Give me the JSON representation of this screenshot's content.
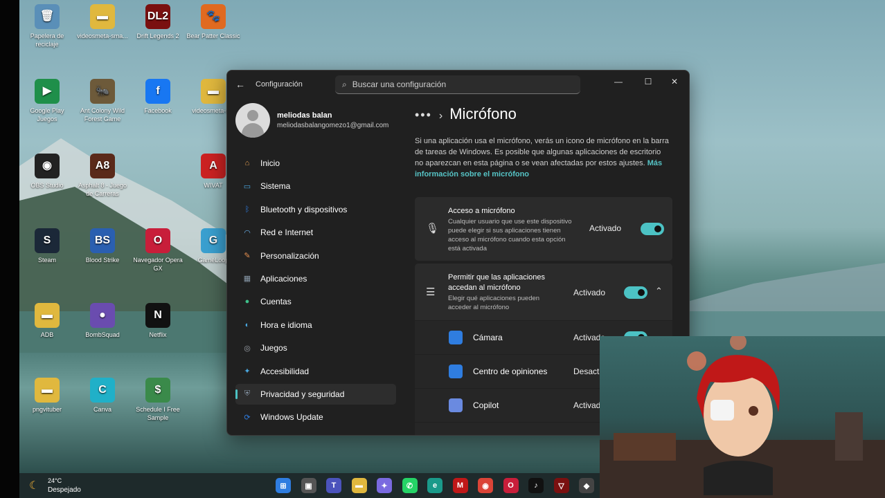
{
  "desktop": {
    "icons": [
      {
        "label": "Papelera de reciclaje",
        "glyph": "🗑",
        "color": "#5a8fb8"
      },
      {
        "label": "videosmeta-sma...",
        "glyph": "▬",
        "color": "#e0b83e"
      },
      {
        "label": "Drift Legends 2",
        "glyph": "DL2",
        "color": "#7a1010"
      },
      {
        "label": "Bear Patter Classic",
        "glyph": "🐾",
        "color": "#e06a20"
      },
      {
        "label": "Google Play Juegos",
        "glyph": "▶",
        "color": "#1f8f4a"
      },
      {
        "label": "Ant Colony Wild Forest Game",
        "glyph": "🐜",
        "color": "#6d5a3a"
      },
      {
        "label": "Facebook",
        "glyph": "f",
        "color": "#1877f2"
      },
      {
        "label": "videosmeta-n...",
        "glyph": "▬",
        "color": "#e0b83e"
      },
      {
        "label": "OBS Studio",
        "glyph": "◉",
        "color": "#222"
      },
      {
        "label": "Asphalt 8 - Juego de Carreras",
        "glyph": "A8",
        "color": "#5a2a1a"
      },
      {
        "label": "WIVAT",
        "glyph": "A",
        "color": "#cc2222"
      },
      {
        "label": "Steam",
        "glyph": "S",
        "color": "#1b2838"
      },
      {
        "label": "Blood Strike",
        "glyph": "BS",
        "color": "#2a5fb0"
      },
      {
        "label": "Navegador Opera GX",
        "glyph": "O",
        "color": "#c81e3a"
      },
      {
        "label": "GameLoop",
        "glyph": "G",
        "color": "#3aa0d0"
      },
      {
        "label": "ADB",
        "glyph": "▬",
        "color": "#e0b83e"
      },
      {
        "label": "BombSquad",
        "glyph": "●",
        "color": "#6a4caf"
      },
      {
        "label": "Netflix",
        "glyph": "N",
        "color": "#111"
      },
      {
        "label": "pngvituber",
        "glyph": "▬",
        "color": "#e0b83e"
      },
      {
        "label": "Canva",
        "glyph": "C",
        "color": "#20b0c8"
      },
      {
        "label": "Schedule I Free Sample",
        "glyph": "$",
        "color": "#3a8a4a"
      }
    ]
  },
  "window": {
    "title": "Configuración",
    "back_icon": "back-arrow-icon",
    "search_placeholder": "Buscar una configuración",
    "controls": {
      "minimize": "—",
      "maximize": "☐",
      "close": "✕"
    },
    "profile": {
      "name": "meliodas balan",
      "email": "meliodasbalangomezo1@gmail.com"
    },
    "nav": [
      {
        "label": "Inicio",
        "icon": "home-icon",
        "glyph": "⌂",
        "color": "#e8a050"
      },
      {
        "label": "Sistema",
        "icon": "system-icon",
        "glyph": "▭",
        "color": "#4aa8e0"
      },
      {
        "label": "Bluetooth y dispositivos",
        "icon": "bluetooth-icon",
        "glyph": "ᛒ",
        "color": "#2f7de0"
      },
      {
        "label": "Red e Internet",
        "icon": "wifi-icon",
        "glyph": "◠",
        "color": "#6ab0e8"
      },
      {
        "label": "Personalización",
        "icon": "brush-icon",
        "glyph": "✎",
        "color": "#e89050"
      },
      {
        "label": "Aplicaciones",
        "icon": "apps-icon",
        "glyph": "▦",
        "color": "#8898a8"
      },
      {
        "label": "Cuentas",
        "icon": "accounts-icon",
        "glyph": "●",
        "color": "#3ec08a"
      },
      {
        "label": "Hora e idioma",
        "icon": "globe-icon",
        "glyph": "◐",
        "color": "#4aa8e0"
      },
      {
        "label": "Juegos",
        "icon": "gamepad-icon",
        "glyph": "◎",
        "color": "#9aa0a8"
      },
      {
        "label": "Accesibilidad",
        "icon": "accessibility-icon",
        "glyph": "✦",
        "color": "#4aa8e0"
      },
      {
        "label": "Privacidad y seguridad",
        "icon": "shield-icon",
        "glyph": "⛨",
        "color": "#8898a8"
      },
      {
        "label": "Windows Update",
        "icon": "update-icon",
        "glyph": "⟳",
        "color": "#2f7de0"
      }
    ],
    "active_nav_index": 10,
    "page": {
      "breadcrumb_dots": "•••",
      "breadcrumb_arrow": "›",
      "title": "Micrófono",
      "description": "Si una aplicación usa el micrófono, verás un icono de micrófono en la barra de tareas de Windows. Es posible que algunas aplicaciones de escritorio no aparezcan en esta página o se vean afectadas por estos ajustes.",
      "link": "Más información sobre el micrófono",
      "access": {
        "title": "Acceso a micrófono",
        "subtitle": "Cualquier usuario que use este dispositivo puede elegir si sus aplicaciones tienen acceso al micrófono cuando esta opción está activada",
        "state": "Activado"
      },
      "apps_access": {
        "title": "Permitir que las aplicaciones accedan al micrófono",
        "subtitle": "Elegir qué aplicaciones pueden acceder al micrófono",
        "state": "Activado"
      },
      "apps": [
        {
          "name": "Cámara",
          "state": "Activado",
          "color": "#2f7de0"
        },
        {
          "name": "Centro de opiniones",
          "state": "Desactivado",
          "color": "#2f7de0"
        },
        {
          "name": "Copilot",
          "state": "Activado",
          "color": "#6a8ae0"
        }
      ]
    }
  },
  "taskbar": {
    "weather": {
      "temp": "24°C",
      "condition": "Despejado"
    },
    "icons": [
      {
        "name": "start-icon",
        "glyph": "⊞",
        "color": "#2f7de0"
      },
      {
        "name": "task-view-icon",
        "glyph": "▣",
        "color": "#555"
      },
      {
        "name": "teams-icon",
        "glyph": "T",
        "color": "#4b53bc"
      },
      {
        "name": "file-explorer-icon",
        "glyph": "▬",
        "color": "#e0b83e"
      },
      {
        "name": "copilot-icon",
        "glyph": "✦",
        "color": "#7a6ae0"
      },
      {
        "name": "whatsapp-icon",
        "glyph": "✆",
        "color": "#25d366"
      },
      {
        "name": "edge-icon",
        "glyph": "e",
        "color": "#1a9a8a"
      },
      {
        "name": "mcafee-icon",
        "glyph": "M",
        "color": "#c01818"
      },
      {
        "name": "chrome-icon",
        "glyph": "◉",
        "color": "#db4437"
      },
      {
        "name": "opera-gx-icon",
        "glyph": "O",
        "color": "#c81e3a"
      },
      {
        "name": "tiktok-icon",
        "glyph": "♪",
        "color": "#111"
      },
      {
        "name": "drift-icon",
        "glyph": "▽",
        "color": "#7a1010"
      },
      {
        "name": "app-icon",
        "glyph": "◆",
        "color": "#444"
      }
    ]
  }
}
